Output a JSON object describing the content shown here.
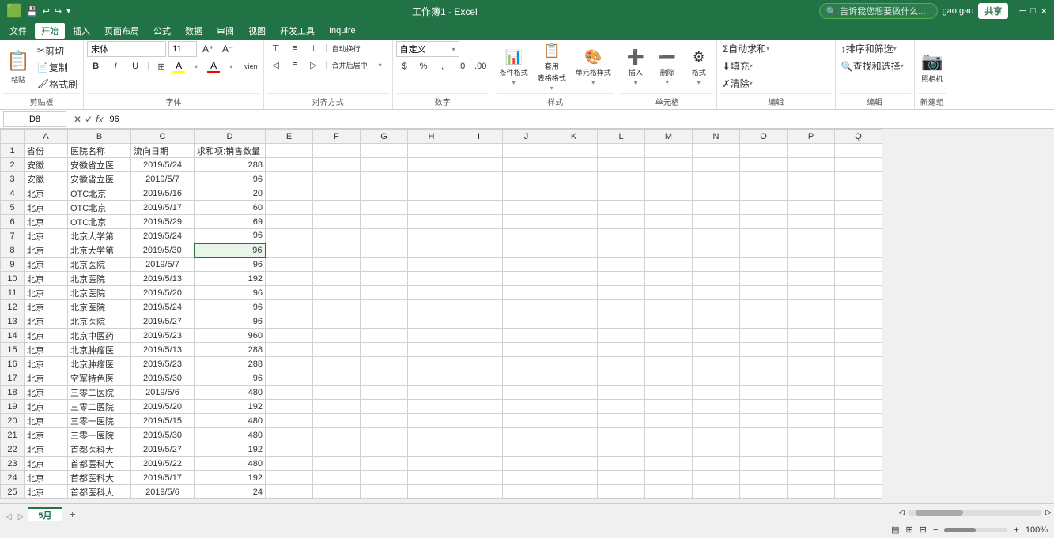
{
  "titleBar": {
    "title": "工作簿1 - Excel",
    "userName": "gao gao",
    "shareBtn": "共享",
    "windowControls": [
      "—",
      "□",
      "✕"
    ]
  },
  "menuBar": {
    "items": [
      "文件",
      "开始",
      "插入",
      "页面布局",
      "公式",
      "数据",
      "审阅",
      "视图",
      "开发工具",
      "Inquire"
    ],
    "activeItem": "开始",
    "searchPlaceholder": "告诉我您想要做什么..."
  },
  "ribbon": {
    "groups": [
      {
        "label": "剪贴板",
        "buttons": [
          "粘贴",
          "剪切",
          "复制",
          "格式刷"
        ]
      },
      {
        "label": "字体",
        "fontName": "宋体",
        "fontSize": "11",
        "buttons": [
          "B",
          "I",
          "U",
          "边框",
          "填充色",
          "字体颜色"
        ]
      },
      {
        "label": "对齐方式",
        "buttons": [
          "自动换行",
          "合并后居中"
        ]
      },
      {
        "label": "数字",
        "format": "自定义",
        "buttons": [
          "%",
          ",",
          ".0",
          ".00"
        ]
      },
      {
        "label": "样式",
        "buttons": [
          "条件格式",
          "套用表格格式",
          "单元格样式"
        ]
      },
      {
        "label": "单元格",
        "buttons": [
          "插入",
          "删除",
          "格式"
        ]
      },
      {
        "label": "编辑",
        "buttons": [
          "自动求和",
          "填充",
          "清除",
          "排序和筛选",
          "查找和选择"
        ]
      },
      {
        "label": "新建组",
        "buttons": [
          "照相机"
        ]
      }
    ]
  },
  "formulaBar": {
    "cellRef": "D8",
    "formula": "96"
  },
  "columnHeaders": [
    "A",
    "B",
    "C",
    "D",
    "E",
    "F",
    "G",
    "H",
    "I",
    "J",
    "K",
    "L",
    "M",
    "N",
    "O",
    "P",
    "Q"
  ],
  "rows": [
    {
      "row": 1,
      "cells": [
        "省份",
        "医院名称",
        "流向日期",
        "求和项:销售数量",
        "",
        "",
        "",
        "",
        "",
        "",
        "",
        "",
        "",
        "",
        "",
        "",
        ""
      ]
    },
    {
      "row": 2,
      "cells": [
        "安徽",
        "安徽省立医",
        "2019/5/24",
        "288",
        "",
        "",
        "",
        "",
        "",
        "",
        "",
        "",
        "",
        "",
        "",
        "",
        ""
      ]
    },
    {
      "row": 3,
      "cells": [
        "安徽",
        "安徽省立医",
        "2019/5/7",
        "96",
        "",
        "",
        "",
        "",
        "",
        "",
        "",
        "",
        "",
        "",
        "",
        "",
        ""
      ]
    },
    {
      "row": 4,
      "cells": [
        "北京",
        "OTC北京",
        "2019/5/16",
        "20",
        "",
        "",
        "",
        "",
        "",
        "",
        "",
        "",
        "",
        "",
        "",
        "",
        ""
      ]
    },
    {
      "row": 5,
      "cells": [
        "北京",
        "OTC北京",
        "2019/5/17",
        "60",
        "",
        "",
        "",
        "",
        "",
        "",
        "",
        "",
        "",
        "",
        "",
        "",
        ""
      ]
    },
    {
      "row": 6,
      "cells": [
        "北京",
        "OTC北京",
        "2019/5/29",
        "69",
        "",
        "",
        "",
        "",
        "",
        "",
        "",
        "",
        "",
        "",
        "",
        "",
        ""
      ]
    },
    {
      "row": 7,
      "cells": [
        "北京",
        "北京大学第",
        "2019/5/24",
        "96",
        "",
        "",
        "",
        "",
        "",
        "",
        "",
        "",
        "",
        "",
        "",
        "",
        ""
      ]
    },
    {
      "row": 8,
      "cells": [
        "北京",
        "北京大学第",
        "2019/5/30",
        "96",
        "",
        "",
        "",
        "",
        "",
        "",
        "",
        "",
        "",
        "",
        "",
        "",
        ""
      ]
    },
    {
      "row": 9,
      "cells": [
        "北京",
        "北京医院",
        "2019/5/7",
        "96",
        "",
        "",
        "",
        "",
        "",
        "",
        "",
        "",
        "",
        "",
        "",
        "",
        ""
      ]
    },
    {
      "row": 10,
      "cells": [
        "北京",
        "北京医院",
        "2019/5/13",
        "192",
        "",
        "",
        "",
        "",
        "",
        "",
        "",
        "",
        "",
        "",
        "",
        "",
        ""
      ]
    },
    {
      "row": 11,
      "cells": [
        "北京",
        "北京医院",
        "2019/5/20",
        "96",
        "",
        "",
        "",
        "",
        "",
        "",
        "",
        "",
        "",
        "",
        "",
        "",
        ""
      ]
    },
    {
      "row": 12,
      "cells": [
        "北京",
        "北京医院",
        "2019/5/24",
        "96",
        "",
        "",
        "",
        "",
        "",
        "",
        "",
        "",
        "",
        "",
        "",
        "",
        ""
      ]
    },
    {
      "row": 13,
      "cells": [
        "北京",
        "北京医院",
        "2019/5/27",
        "96",
        "",
        "",
        "",
        "",
        "",
        "",
        "",
        "",
        "",
        "",
        "",
        "",
        ""
      ]
    },
    {
      "row": 14,
      "cells": [
        "北京",
        "北京中医药",
        "2019/5/23",
        "960",
        "",
        "",
        "",
        "",
        "",
        "",
        "",
        "",
        "",
        "",
        "",
        "",
        ""
      ]
    },
    {
      "row": 15,
      "cells": [
        "北京",
        "北京肿瘤医",
        "2019/5/13",
        "288",
        "",
        "",
        "",
        "",
        "",
        "",
        "",
        "",
        "",
        "",
        "",
        "",
        ""
      ]
    },
    {
      "row": 16,
      "cells": [
        "北京",
        "北京肿瘤医",
        "2019/5/23",
        "288",
        "",
        "",
        "",
        "",
        "",
        "",
        "",
        "",
        "",
        "",
        "",
        "",
        ""
      ]
    },
    {
      "row": 17,
      "cells": [
        "北京",
        "空军特色医",
        "2019/5/30",
        "96",
        "",
        "",
        "",
        "",
        "",
        "",
        "",
        "",
        "",
        "",
        "",
        "",
        ""
      ]
    },
    {
      "row": 18,
      "cells": [
        "北京",
        "三零二医院",
        "2019/5/6",
        "480",
        "",
        "",
        "",
        "",
        "",
        "",
        "",
        "",
        "",
        "",
        "",
        "",
        ""
      ]
    },
    {
      "row": 19,
      "cells": [
        "北京",
        "三零二医院",
        "2019/5/20",
        "192",
        "",
        "",
        "",
        "",
        "",
        "",
        "",
        "",
        "",
        "",
        "",
        "",
        ""
      ]
    },
    {
      "row": 20,
      "cells": [
        "北京",
        "三零一医院",
        "2019/5/15",
        "480",
        "",
        "",
        "",
        "",
        "",
        "",
        "",
        "",
        "",
        "",
        "",
        "",
        ""
      ]
    },
    {
      "row": 21,
      "cells": [
        "北京",
        "三零一医院",
        "2019/5/30",
        "480",
        "",
        "",
        "",
        "",
        "",
        "",
        "",
        "",
        "",
        "",
        "",
        "",
        ""
      ]
    },
    {
      "row": 22,
      "cells": [
        "北京",
        "首都医科大",
        "2019/5/27",
        "192",
        "",
        "",
        "",
        "",
        "",
        "",
        "",
        "",
        "",
        "",
        "",
        "",
        ""
      ]
    },
    {
      "row": 23,
      "cells": [
        "北京",
        "首都医科大",
        "2019/5/22",
        "480",
        "",
        "",
        "",
        "",
        "",
        "",
        "",
        "",
        "",
        "",
        "",
        "",
        ""
      ]
    },
    {
      "row": 24,
      "cells": [
        "北京",
        "首都医科大",
        "2019/5/17",
        "192",
        "",
        "",
        "",
        "",
        "",
        "",
        "",
        "",
        "",
        "",
        "",
        "",
        ""
      ]
    },
    {
      "row": 25,
      "cells": [
        "北京",
        "首都医科大",
        "2019/5/6",
        "24",
        "",
        "",
        "",
        "",
        "",
        "",
        "",
        "",
        "",
        "",
        "",
        "",
        ""
      ]
    }
  ],
  "selectedCell": {
    "row": 8,
    "col": 3
  },
  "sheetTabs": [
    "5月"
  ],
  "statusBar": {
    "left": "",
    "right": ""
  },
  "colors": {
    "accent": "#217346",
    "highlight": "#e8f5e9"
  }
}
